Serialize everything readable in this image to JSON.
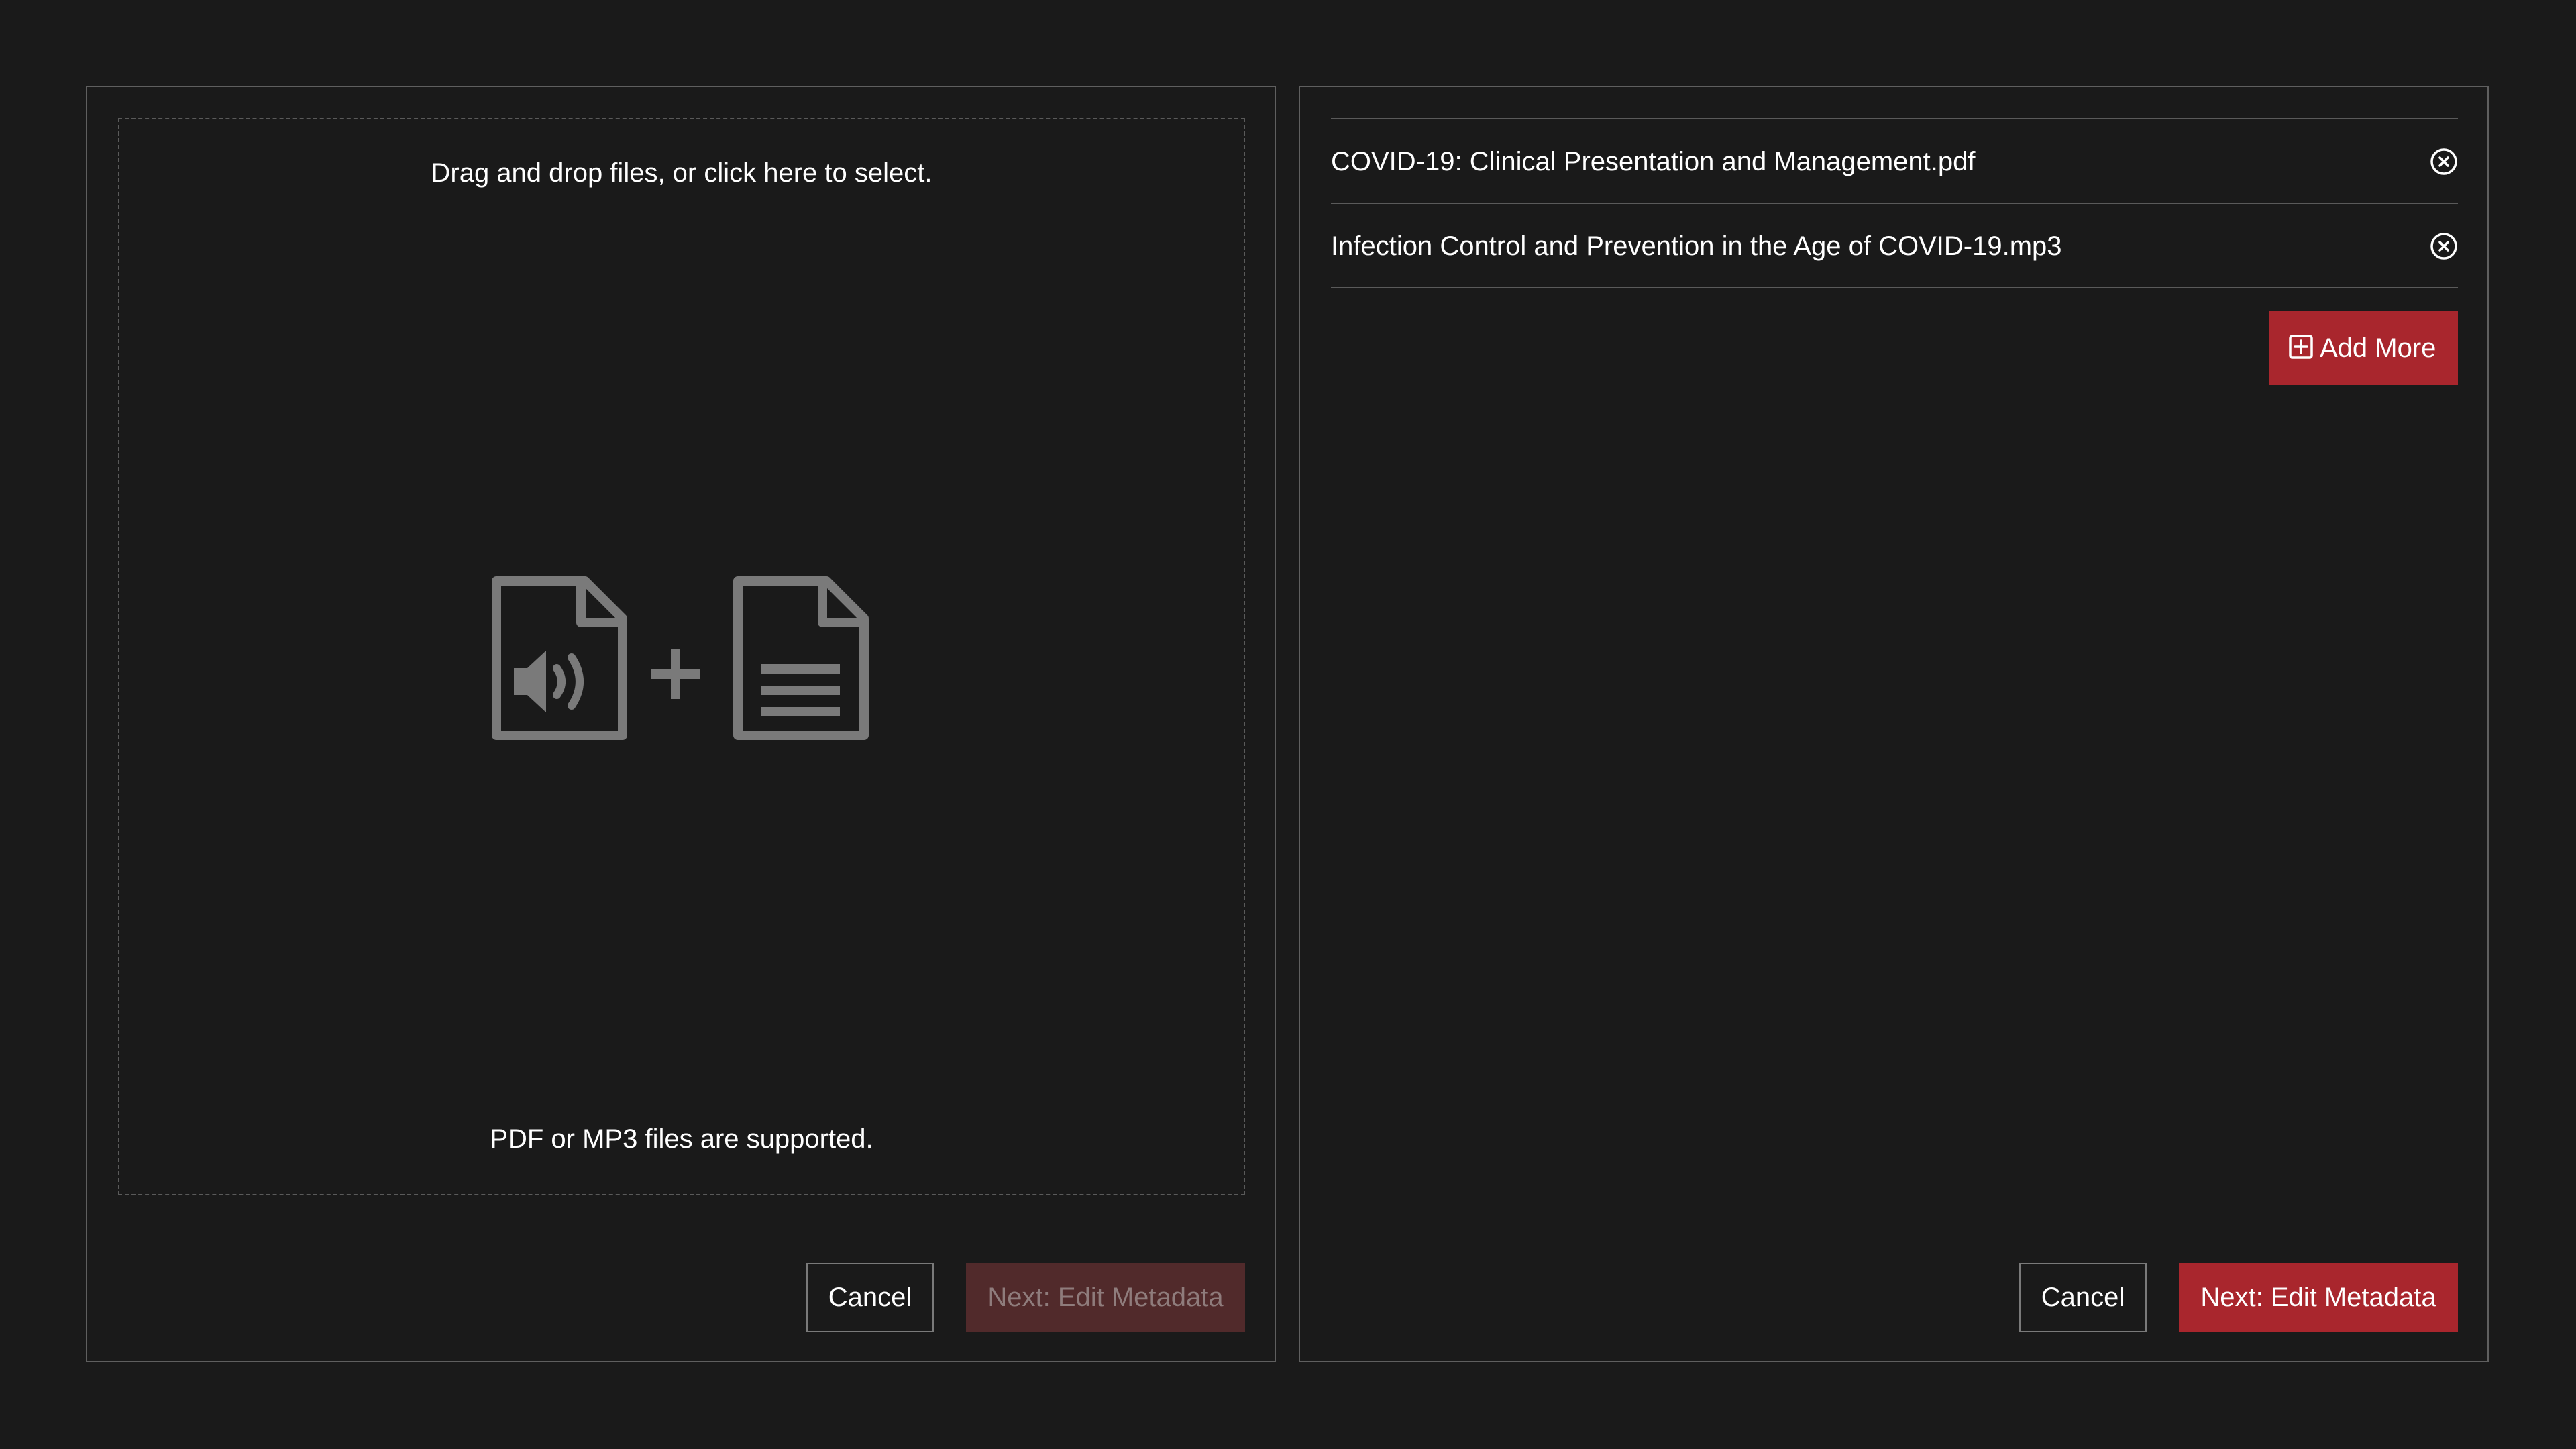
{
  "upload_panel": {
    "dropzone_instruction": "Drag and drop files, or click here to select.",
    "supported_formats": "PDF or MP3 files are supported.",
    "icons": [
      "audio-file-icon",
      "plus-icon",
      "document-file-icon"
    ],
    "cancel_label": "Cancel",
    "next_label": "Next: Edit Metadata",
    "next_enabled": false
  },
  "files_panel": {
    "files": [
      {
        "name": "COVID-19: Clinical Presentation and Management.pdf",
        "remove_icon": "close-circle-icon"
      },
      {
        "name": "Infection Control and Prevention in the Age of COVID-19.mp3",
        "remove_icon": "close-circle-icon"
      }
    ],
    "add_more_label": "Add More",
    "add_more_icon": "plus-square-icon",
    "cancel_label": "Cancel",
    "next_label": "Next: Edit Metadata",
    "next_enabled": true
  },
  "colors": {
    "background": "#1a1a1a",
    "accent": "#a9262d",
    "accent_disabled": "#512a2b",
    "border": "#5f5f5f",
    "icon_gray": "#7a7a7a"
  }
}
